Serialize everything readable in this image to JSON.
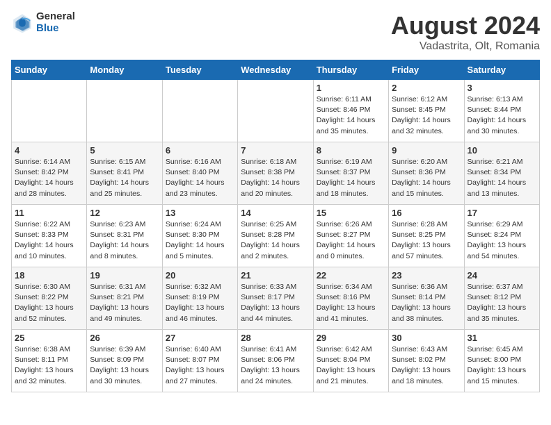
{
  "header": {
    "logo_general": "General",
    "logo_blue": "Blue",
    "month_title": "August 2024",
    "subtitle": "Vadastrita, Olt, Romania"
  },
  "calendar": {
    "days_of_week": [
      "Sunday",
      "Monday",
      "Tuesday",
      "Wednesday",
      "Thursday",
      "Friday",
      "Saturday"
    ],
    "weeks": [
      [
        {
          "day": "",
          "info": ""
        },
        {
          "day": "",
          "info": ""
        },
        {
          "day": "",
          "info": ""
        },
        {
          "day": "",
          "info": ""
        },
        {
          "day": "1",
          "info": "Sunrise: 6:11 AM\nSunset: 8:46 PM\nDaylight: 14 hours\nand 35 minutes."
        },
        {
          "day": "2",
          "info": "Sunrise: 6:12 AM\nSunset: 8:45 PM\nDaylight: 14 hours\nand 32 minutes."
        },
        {
          "day": "3",
          "info": "Sunrise: 6:13 AM\nSunset: 8:44 PM\nDaylight: 14 hours\nand 30 minutes."
        }
      ],
      [
        {
          "day": "4",
          "info": "Sunrise: 6:14 AM\nSunset: 8:42 PM\nDaylight: 14 hours\nand 28 minutes."
        },
        {
          "day": "5",
          "info": "Sunrise: 6:15 AM\nSunset: 8:41 PM\nDaylight: 14 hours\nand 25 minutes."
        },
        {
          "day": "6",
          "info": "Sunrise: 6:16 AM\nSunset: 8:40 PM\nDaylight: 14 hours\nand 23 minutes."
        },
        {
          "day": "7",
          "info": "Sunrise: 6:18 AM\nSunset: 8:38 PM\nDaylight: 14 hours\nand 20 minutes."
        },
        {
          "day": "8",
          "info": "Sunrise: 6:19 AM\nSunset: 8:37 PM\nDaylight: 14 hours\nand 18 minutes."
        },
        {
          "day": "9",
          "info": "Sunrise: 6:20 AM\nSunset: 8:36 PM\nDaylight: 14 hours\nand 15 minutes."
        },
        {
          "day": "10",
          "info": "Sunrise: 6:21 AM\nSunset: 8:34 PM\nDaylight: 14 hours\nand 13 minutes."
        }
      ],
      [
        {
          "day": "11",
          "info": "Sunrise: 6:22 AM\nSunset: 8:33 PM\nDaylight: 14 hours\nand 10 minutes."
        },
        {
          "day": "12",
          "info": "Sunrise: 6:23 AM\nSunset: 8:31 PM\nDaylight: 14 hours\nand 8 minutes."
        },
        {
          "day": "13",
          "info": "Sunrise: 6:24 AM\nSunset: 8:30 PM\nDaylight: 14 hours\nand 5 minutes."
        },
        {
          "day": "14",
          "info": "Sunrise: 6:25 AM\nSunset: 8:28 PM\nDaylight: 14 hours\nand 2 minutes."
        },
        {
          "day": "15",
          "info": "Sunrise: 6:26 AM\nSunset: 8:27 PM\nDaylight: 14 hours\nand 0 minutes."
        },
        {
          "day": "16",
          "info": "Sunrise: 6:28 AM\nSunset: 8:25 PM\nDaylight: 13 hours\nand 57 minutes."
        },
        {
          "day": "17",
          "info": "Sunrise: 6:29 AM\nSunset: 8:24 PM\nDaylight: 13 hours\nand 54 minutes."
        }
      ],
      [
        {
          "day": "18",
          "info": "Sunrise: 6:30 AM\nSunset: 8:22 PM\nDaylight: 13 hours\nand 52 minutes."
        },
        {
          "day": "19",
          "info": "Sunrise: 6:31 AM\nSunset: 8:21 PM\nDaylight: 13 hours\nand 49 minutes."
        },
        {
          "day": "20",
          "info": "Sunrise: 6:32 AM\nSunset: 8:19 PM\nDaylight: 13 hours\nand 46 minutes."
        },
        {
          "day": "21",
          "info": "Sunrise: 6:33 AM\nSunset: 8:17 PM\nDaylight: 13 hours\nand 44 minutes."
        },
        {
          "day": "22",
          "info": "Sunrise: 6:34 AM\nSunset: 8:16 PM\nDaylight: 13 hours\nand 41 minutes."
        },
        {
          "day": "23",
          "info": "Sunrise: 6:36 AM\nSunset: 8:14 PM\nDaylight: 13 hours\nand 38 minutes."
        },
        {
          "day": "24",
          "info": "Sunrise: 6:37 AM\nSunset: 8:12 PM\nDaylight: 13 hours\nand 35 minutes."
        }
      ],
      [
        {
          "day": "25",
          "info": "Sunrise: 6:38 AM\nSunset: 8:11 PM\nDaylight: 13 hours\nand 32 minutes."
        },
        {
          "day": "26",
          "info": "Sunrise: 6:39 AM\nSunset: 8:09 PM\nDaylight: 13 hours\nand 30 minutes."
        },
        {
          "day": "27",
          "info": "Sunrise: 6:40 AM\nSunset: 8:07 PM\nDaylight: 13 hours\nand 27 minutes."
        },
        {
          "day": "28",
          "info": "Sunrise: 6:41 AM\nSunset: 8:06 PM\nDaylight: 13 hours\nand 24 minutes."
        },
        {
          "day": "29",
          "info": "Sunrise: 6:42 AM\nSunset: 8:04 PM\nDaylight: 13 hours\nand 21 minutes."
        },
        {
          "day": "30",
          "info": "Sunrise: 6:43 AM\nSunset: 8:02 PM\nDaylight: 13 hours\nand 18 minutes."
        },
        {
          "day": "31",
          "info": "Sunrise: 6:45 AM\nSunset: 8:00 PM\nDaylight: 13 hours\nand 15 minutes."
        }
      ]
    ]
  }
}
